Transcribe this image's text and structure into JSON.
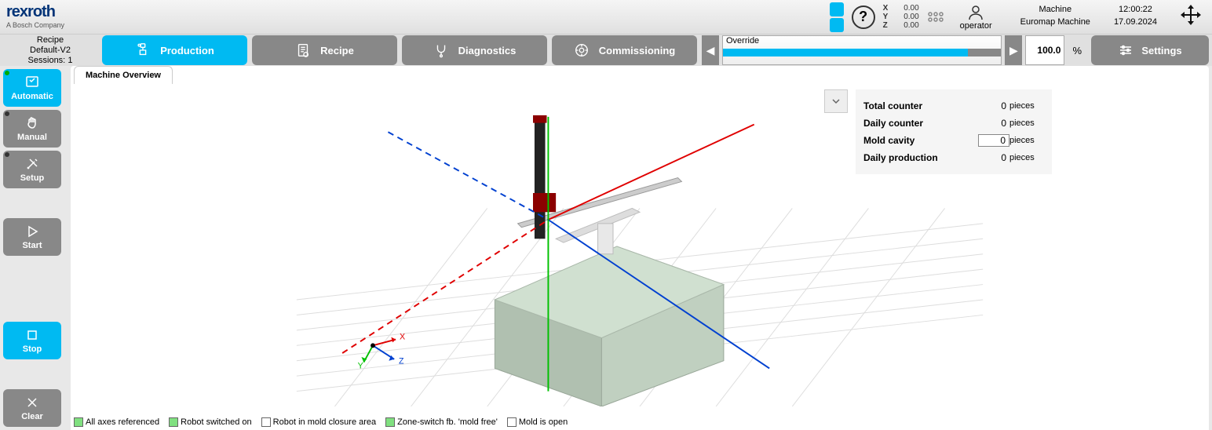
{
  "logo": {
    "main": "rexroth",
    "sub": "A Bosch Company"
  },
  "axes": [
    {
      "name": "X",
      "value": "0.00"
    },
    {
      "name": "Y",
      "value": "0.00"
    },
    {
      "name": "Z",
      "value": "0.00"
    }
  ],
  "operator": "operator",
  "machine": {
    "label": "Machine",
    "name": "Euromap Machine",
    "time": "12:00:22",
    "date": "17.09.2024"
  },
  "recipe": {
    "label": "Recipe",
    "name": "Default-V2",
    "sessions_label": "Sessions:",
    "sessions": "1"
  },
  "nav": {
    "production": "Production",
    "recipe": "Recipe",
    "diagnostics": "Diagnostics",
    "commissioning": "Commissioning"
  },
  "override": {
    "label": "Override",
    "value": "100.0",
    "unit": "%"
  },
  "settings": "Settings",
  "side": {
    "automatic": "Automatic",
    "manual": "Manual",
    "setup": "Setup",
    "start": "Start",
    "stop": "Stop",
    "clear": "Clear"
  },
  "tab": "Machine Overview",
  "counters": {
    "total": {
      "label": "Total counter",
      "value": "0",
      "unit": "pieces"
    },
    "daily": {
      "label": "Daily counter",
      "value": "0",
      "unit": "pieces"
    },
    "cavity": {
      "label": "Mold cavity",
      "value": "0",
      "unit": "pieces"
    },
    "production": {
      "label": "Daily production",
      "value": "0",
      "unit": "pieces"
    }
  },
  "status": {
    "axes_ref": "All axes referenced",
    "robot_on": "Robot switched on",
    "mold_closure": "Robot in mold closure area",
    "zone_switch": "Zone-switch fb. 'mold free'",
    "mold_open": "Mold is open"
  },
  "axis_labels": {
    "x": "X",
    "y": "Y",
    "z": "Z"
  }
}
